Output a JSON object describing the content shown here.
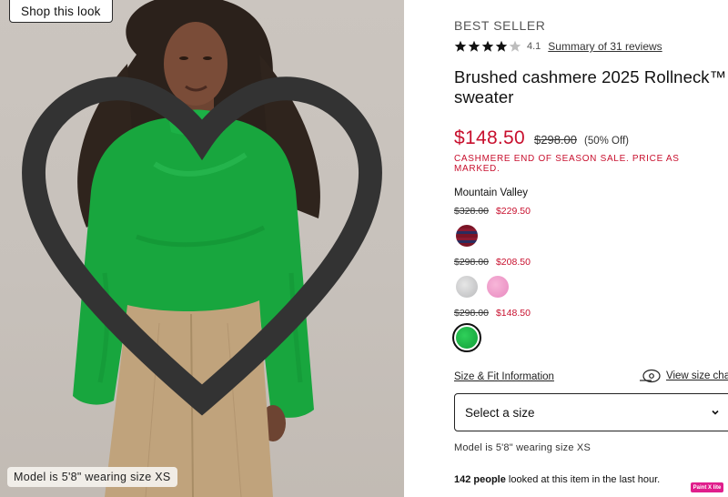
{
  "photo": {
    "shop_look_label": "Shop this look",
    "model_caption": "Model is 5'8\" wearing size XS"
  },
  "product": {
    "eyebrow": "BEST SELLER",
    "rating_value": "4.1",
    "rating_stars": 4.1,
    "reviews_link": "Summary of 31 reviews",
    "title": "Brushed cashmere 2025 Rollneck™ sweater",
    "price_now": "$148.50",
    "price_was": "$298.00",
    "price_off": "(50% Off)",
    "sale_message": "CASHMERE END OF SEASON SALE. PRICE AS MARKED."
  },
  "colors": {
    "selected_name": "Mountain Valley",
    "tiers": [
      {
        "was": "$328.00",
        "now": "$229.50"
      },
      {
        "was": "$298.00",
        "now": "$208.50"
      },
      {
        "was": "$298.00",
        "now": "$148.50"
      }
    ]
  },
  "sizing": {
    "fit_link": "Size & Fit Information",
    "size_chart_link": "View size chart",
    "select_label": "Select a size",
    "model_info": "Model is 5'8\" wearing size XS"
  },
  "social": {
    "count": "142 people",
    "rest": " looked at this item in the last hour."
  },
  "badge": {
    "label": "Paint X lite"
  },
  "theme": {
    "sale_red": "#c8102e",
    "sweater_green": "#18a63e"
  }
}
